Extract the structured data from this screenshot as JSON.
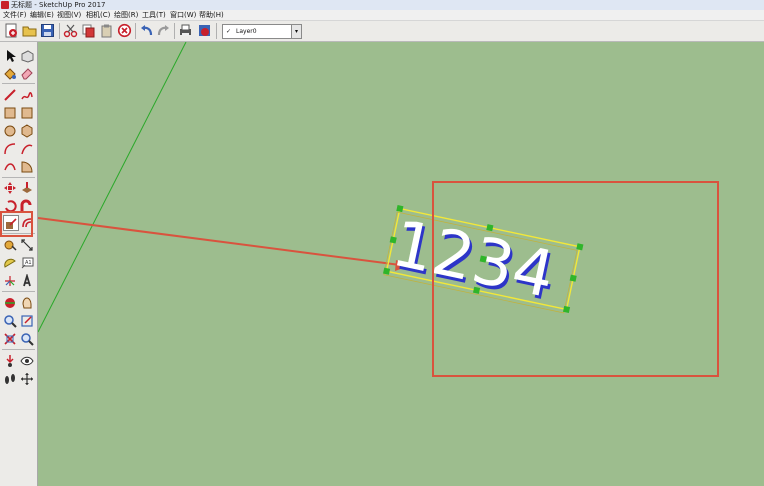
{
  "window": {
    "title": "无标题 - SketchUp Pro 2017"
  },
  "menubar": {
    "items": [
      "文件(F)",
      "编辑(E)",
      "视图(V)",
      "相机(C)",
      "绘图(R)",
      "工具(T)",
      "窗口(W)",
      "帮助(H)"
    ]
  },
  "toolbar": {
    "layer_check": "✓",
    "layer_value": "Layer0",
    "dropdown_arrow": "▾"
  },
  "canvas": {
    "model_text": "1234",
    "colors": {
      "background": "#9dbd8e",
      "text_fill": "#ffffff",
      "text_edge": "#2d35c8",
      "selection": "#f3e838",
      "grips": "#2fb52a",
      "highlight": "#d9533e",
      "axis_green": "#2aa82a"
    }
  }
}
